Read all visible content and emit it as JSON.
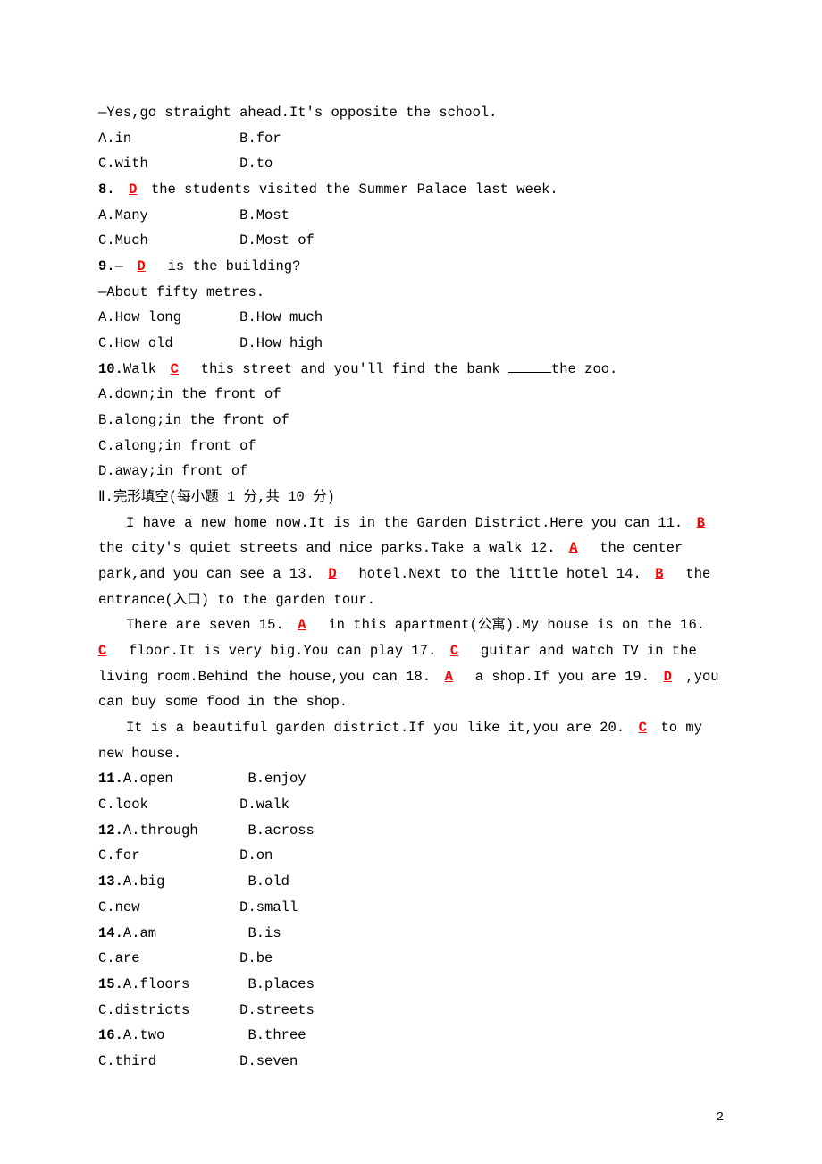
{
  "q7": {
    "line1_a": "—Yes,go straight ahead.It's opposite the school.",
    "optA": "A.in",
    "optB": "B.for",
    "optC": "C.with",
    "optD": "D.to"
  },
  "q8": {
    "num": "8.",
    "ans": "D",
    "textAfter": "the students visited the Summer Palace last week.",
    "optA": "A.Many",
    "optB": "B.Most",
    "optC": "C.Much",
    "optD": "D.Most of"
  },
  "q9": {
    "num": "9.",
    "dash": "—",
    "ans": "D",
    "textAfter": " is the building?",
    "line2": "—About fifty metres.",
    "optA": "A.How long",
    "optB": "B.How much",
    "optC": "C.How old",
    "optD": "D.How high"
  },
  "q10": {
    "num": "10.",
    "textBefore": "Walk",
    "ans": "C",
    "textMid": " this street and you'll find the bank ",
    "textAfter": "the zoo.",
    "optA": "A.down;in the front of",
    "optB": "B.along;in the front of",
    "optC": "C.along;in front of",
    "optD": "D.away;in front of"
  },
  "sectionII": "Ⅱ.完形填空(每小题 1 分,共 10 分)",
  "cloze": {
    "p1_a": "I have a new home now.It is in the Garden District.Here you can 11.",
    "a11": "B",
    "p1_b": " the city's quiet streets and nice parks.Take a walk 12.",
    "a12": "A",
    "p1_c": " the center park,and you can see a 13.",
    "a13": "D",
    "p1_d": " hotel.Next to the little hotel 14.",
    "a14": "B",
    "p1_e": " the entrance(入口) to the garden tour.",
    "p2_a": "There are seven 15.",
    "a15": "A",
    "p2_b": " in this apartment(公寓).My house is on the 16.",
    "a16": "C",
    "p2_c": " floor.It is very big.You can play 17.",
    "a17": "C",
    "p2_d": " guitar and watch TV in the living room.Behind the house,you can 18.",
    "a18": "A",
    "p2_e": " a shop.If you are 19.",
    "a19": "D",
    "p2_f": ",you can buy some food in the shop.",
    "p3_a": "It is a beautiful garden district.If you like it,you are 20.",
    "a20": "C",
    "p3_b": "to my new house."
  },
  "opts": {
    "q11": {
      "num": "11.",
      "A": "A.open",
      "B": "B.enjoy",
      "C": "C.look",
      "D": "D.walk"
    },
    "q12": {
      "num": "12.",
      "A": "A.through",
      "B": "B.across",
      "C": "C.for",
      "D": "D.on"
    },
    "q13": {
      "num": "13.",
      "A": "A.big",
      "B": "B.old",
      "C": "C.new",
      "D": "D.small"
    },
    "q14": {
      "num": "14.",
      "A": "A.am",
      "B": "B.is",
      "C": "C.are",
      "D": "D.be"
    },
    "q15": {
      "num": "15.",
      "A": "A.floors",
      "B": "B.places",
      "C": "C.districts",
      "D": "D.streets"
    },
    "q16": {
      "num": "16.",
      "A": "A.two",
      "B": "B.three",
      "C": "C.third",
      "D": "D.seven"
    }
  },
  "pageNumber": "2"
}
